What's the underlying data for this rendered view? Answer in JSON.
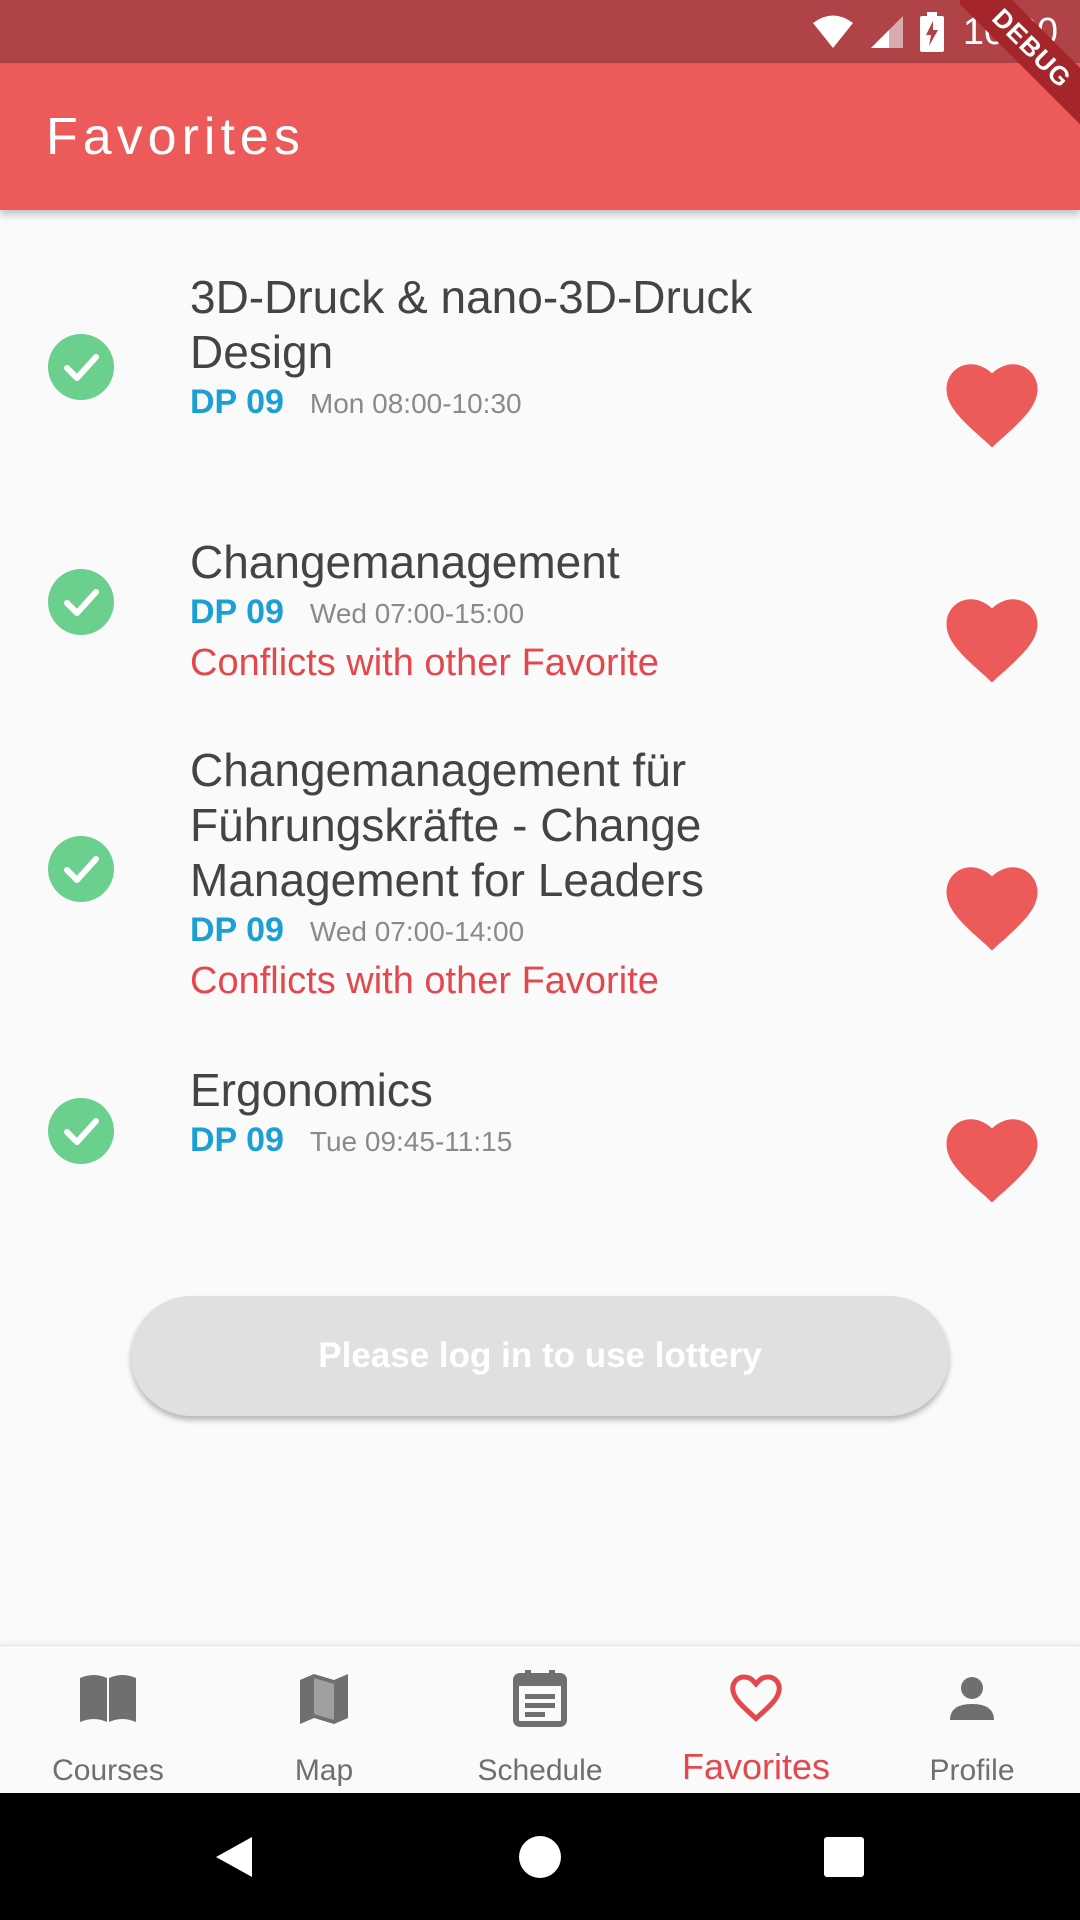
{
  "status_bar": {
    "time": "10:30"
  },
  "debug_banner": "DEBUG",
  "app_bar": {
    "title": "Favorites"
  },
  "favorites": [
    {
      "title_lines": [
        "3D-Druck & nano-3D-Druck",
        "Design"
      ],
      "room": "DP 09",
      "time": "Mon 08:00-10:30",
      "conflict": ""
    },
    {
      "title_lines": [
        "Changemanagement"
      ],
      "room": "DP 09",
      "time": "Wed 07:00-15:00",
      "conflict": "Conflicts with other Favorite"
    },
    {
      "title_lines": [
        "Changemanagement für",
        "Führungskräfte - Change",
        "Management for Leaders"
      ],
      "room": "DP 09",
      "time": "Wed 07:00-14:00",
      "conflict": "Conflicts with other Favorite"
    },
    {
      "title_lines": [
        "Ergonomics"
      ],
      "room": "DP 09",
      "time": "Tue 09:45-11:15",
      "conflict": ""
    }
  ],
  "lottery_button": {
    "label": "Please log in to use lottery"
  },
  "bottom_nav": {
    "items": [
      {
        "label": "Courses",
        "icon": "book-icon"
      },
      {
        "label": "Map",
        "icon": "map-icon"
      },
      {
        "label": "Schedule",
        "icon": "schedule-icon"
      },
      {
        "label": "Favorites",
        "icon": "heart-outline-icon"
      },
      {
        "label": "Profile",
        "icon": "person-icon"
      }
    ],
    "active": "Favorites"
  },
  "colors": {
    "app_bar": "#ec5a5a",
    "status_bar": "#b04347",
    "accent": "#e2484d",
    "check": "#6bcf8e",
    "room": "#1c9fd3"
  }
}
